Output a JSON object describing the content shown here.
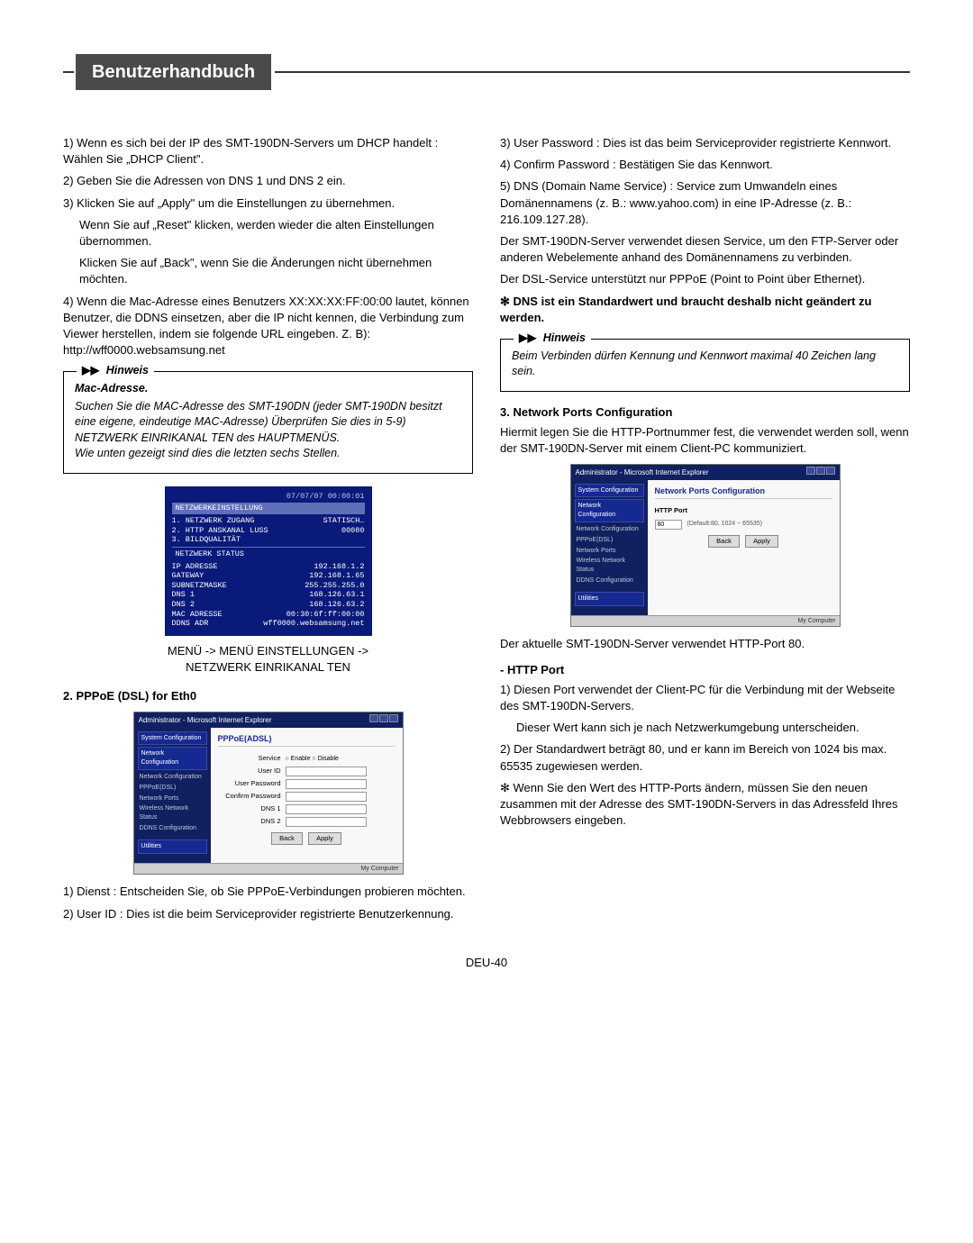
{
  "header": {
    "title": "Benutzerhandbuch"
  },
  "left": {
    "p1": "1) Wenn es sich bei der IP des SMT-190DN-Servers um DHCP handelt : Wählen Sie „DHCP Client\".",
    "p2": "2) Geben Sie die Adressen von DNS 1 und DNS 2 ein.",
    "p3": "3) Klicken Sie auf „Apply\" um die Einstellungen zu übernehmen.",
    "p3a": "Wenn Sie auf „Reset\" klicken, werden wieder die alten Einstellungen übernommen.",
    "p3b": "Klicken Sie auf „Back\", wenn Sie die Änderungen nicht übernehmen möchten.",
    "p4": "4) Wenn die Mac-Adresse eines Benutzers XX:XX:XX:FF:00:00 lautet, können Benutzer, die DDNS einsetzen, aber die IP nicht kennen, die Verbindung zum Viewer herstellen, indem sie folgende URL eingeben. Z. B): http://wff0000.websamsung.net",
    "hinweis": {
      "label": "Hinweis",
      "subhead": "Mac-Adresse.",
      "l1": "Suchen Sie die MAC-Adresse des SMT-190DN (jeder SMT-190DN besitzt eine eigene, eindeutige MAC-Adresse) Überprüfen Sie dies in 5-9) NETZWERK EINRIKANAL TEN des HAUPTMENÜS.",
      "l2": "Wie unten gezeigt sind dies die letzten sechs Stellen."
    },
    "netbox": {
      "ts": "07/07/07  00:00:01",
      "hdr": "NETZWERKEINSTELLUNG",
      "r1a": "1. NETZWERK ZUGANG",
      "r1b": "STATISCH…",
      "r2a": "2. HTTP ANSKANAL LUSS",
      "r2b": "00080",
      "r3a": "3. BILDQUALITÄT",
      "r3b": "",
      "sub": "NETZWERK STATUS",
      "r4a": "IP ADRESSE",
      "r4b": "192.168.1.2",
      "r5a": "GATEWAY",
      "r5b": "192.168.1.65",
      "r6a": "SUBNETZMASKE",
      "r6b": "255.255.255.0",
      "r7a": "DNS 1",
      "r7b": "168.126.63.1",
      "r8a": "DNS 2",
      "r8b": "168.126.63.2",
      "r9a": "MAC ADRESSE",
      "r9b": "00:30:6f:ff:00:00",
      "r10a": "DDNS ADR",
      "r10b": "wff0000.websamsung.net"
    },
    "menupath1": "MENÜ -> MENÜ EINSTELLUNGEN ->",
    "menupath2": "NETZWERK EINRIKANAL TEN",
    "sec2": "2. PPPoE (DSL) for Eth0",
    "shot1": {
      "title": "Administrator - Microsoft Internet Explorer",
      "tab1": "System Configuration",
      "tab2": "Network Configuration",
      "side": [
        "Network Configuration",
        "PPPoE(DSL)",
        "Network Ports",
        "Wireless Network Status",
        "DDNS Configuration"
      ],
      "util": "Utilities",
      "pgtitle": "PPPoE(ADSL)",
      "f_service": "Service",
      "f_service_opts": "○ Enable  ○ Disable",
      "f_user": "User ID",
      "f_pw": "User Password",
      "f_cpw": "Confirm Password",
      "f_dns1": "DNS 1",
      "f_dns2": "DNS 2",
      "btn_back": "Back",
      "btn_apply": "Apply",
      "status": "My Computer"
    },
    "b1": "1) Dienst : Entscheiden Sie, ob Sie PPPoE-Verbindungen probieren möchten.",
    "b2": "2) User ID : Dies ist die beim Serviceprovider registrierte Benutzerkennung."
  },
  "right": {
    "p3": "3) User Password : Dies ist das beim Serviceprovider registrierte Kennwort.",
    "p4": "4) Confirm Password : Bestätigen Sie das Kennwort.",
    "p5": "5) DNS (Domain Name Service) : Service zum Umwandeln eines Domänennamens (z. B.: www.yahoo.com) in eine IP-Adresse (z. B.: 216.109.127.28).",
    "after1": "Der SMT-190DN-Server verwendet diesen Service, um den FTP-Server oder anderen Webelemente anhand des Domänennamens zu verbinden.",
    "after2": "Der DSL-Service unterstützt nur PPPoE (Point to Point über Ethernet).",
    "star": "✻ DNS ist ein Standardwert und braucht deshalb nicht geändert zu werden.",
    "hinweis": {
      "label": "Hinweis",
      "l1": "Beim Verbinden dürfen Kennung und Kennwort maximal 40 Zeichen lang sein."
    },
    "sec3": "3. Network Ports Configuration",
    "sec3p": "Hiermit legen Sie die HTTP-Portnummer fest, die verwendet werden soll, wenn der SMT-190DN-Server mit einem Client-PC kommuniziert.",
    "shot2": {
      "title": "Administrator - Microsoft Internet Explorer",
      "tab1": "System Configuration",
      "tab2": "Network Configuration",
      "side": [
        "Network Configuration",
        "PPPoE(DSL)",
        "Network Ports",
        "Wireless Network Status",
        "DDNS Configuration"
      ],
      "util": "Utilities",
      "pgtitle": "Network Ports Configuration",
      "lblsec": "HTTP Port",
      "val": "80",
      "hint": "(Default:80, 1024 ~ 65535)",
      "btn_back": "Back",
      "btn_apply": "Apply",
      "status": "My Computer"
    },
    "afterShot": "Der aktuelle SMT-190DN-Server verwendet HTTP-Port 80.",
    "httpHead": "- HTTP Port",
    "h1": "1) Diesen Port verwendet der Client-PC für die Verbindung mit der Webseite des SMT-190DN-Servers.",
    "h1a": "Dieser Wert kann sich je nach Netzwerkumgebung unterscheiden.",
    "h2": "2) Der Standardwert beträgt 80, und er kann im Bereich von 1024 bis max. 65535 zugewiesen werden.",
    "hstar": "✻ Wenn Sie den Wert des HTTP-Ports ändern, müssen Sie den neuen zusammen mit der Adresse des SMT-190DN-Servers in das Adressfeld Ihres Webbrowsers eingeben."
  },
  "footer": "DEU-40"
}
